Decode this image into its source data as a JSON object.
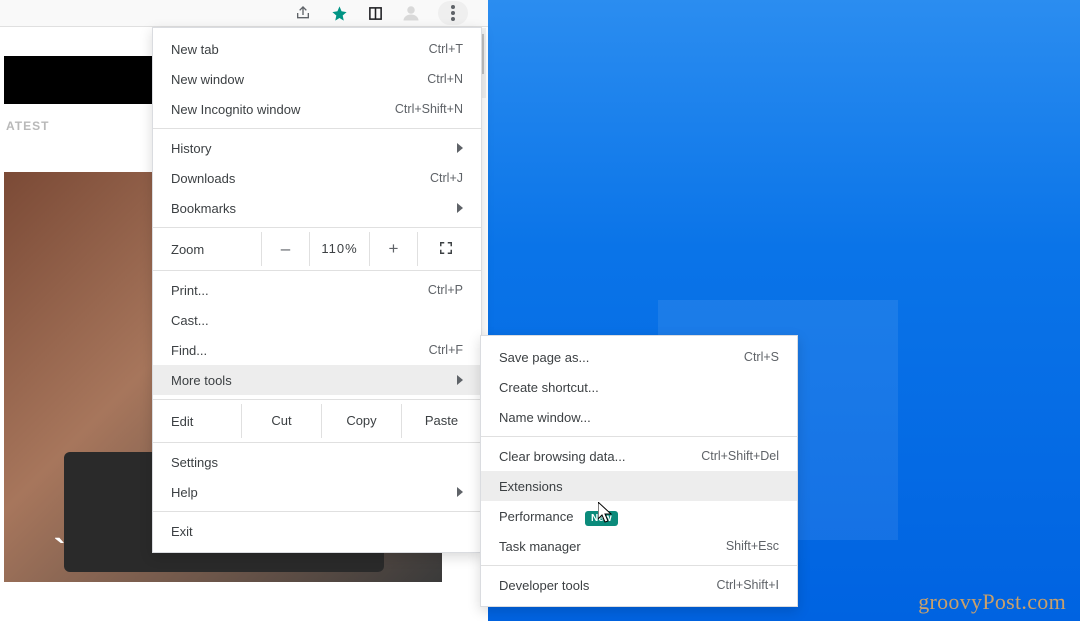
{
  "toolbar": {
    "icons": [
      "share-icon",
      "star-icon",
      "reading-list-icon",
      "profile-icon",
      "menu-icon"
    ]
  },
  "page": {
    "tab_label": "ATEST",
    "photo_text": "`"
  },
  "menu": {
    "new_tab": "New tab",
    "new_tab_sc": "Ctrl+T",
    "new_window": "New window",
    "new_window_sc": "Ctrl+N",
    "new_incognito": "New Incognito window",
    "new_incognito_sc": "Ctrl+Shift+N",
    "history": "History",
    "downloads": "Downloads",
    "downloads_sc": "Ctrl+J",
    "bookmarks": "Bookmarks",
    "zoom_label": "Zoom",
    "zoom_minus": "–",
    "zoom_val": "110%",
    "zoom_plus": "+",
    "print": "Print...",
    "print_sc": "Ctrl+P",
    "cast": "Cast...",
    "find": "Find...",
    "find_sc": "Ctrl+F",
    "more_tools": "More tools",
    "edit_label": "Edit",
    "cut": "Cut",
    "copy": "Copy",
    "paste": "Paste",
    "settings": "Settings",
    "help": "Help",
    "exit": "Exit"
  },
  "submenu": {
    "save_page": "Save page as...",
    "save_page_sc": "Ctrl+S",
    "create_shortcut": "Create shortcut...",
    "name_window": "Name window...",
    "clear_data": "Clear browsing data...",
    "clear_data_sc": "Ctrl+Shift+Del",
    "extensions": "Extensions",
    "performance": "Performance",
    "performance_badge": "New",
    "task_manager": "Task manager",
    "task_manager_sc": "Shift+Esc",
    "dev_tools": "Developer tools",
    "dev_tools_sc": "Ctrl+Shift+I"
  },
  "watermark": "groovyPost.com"
}
